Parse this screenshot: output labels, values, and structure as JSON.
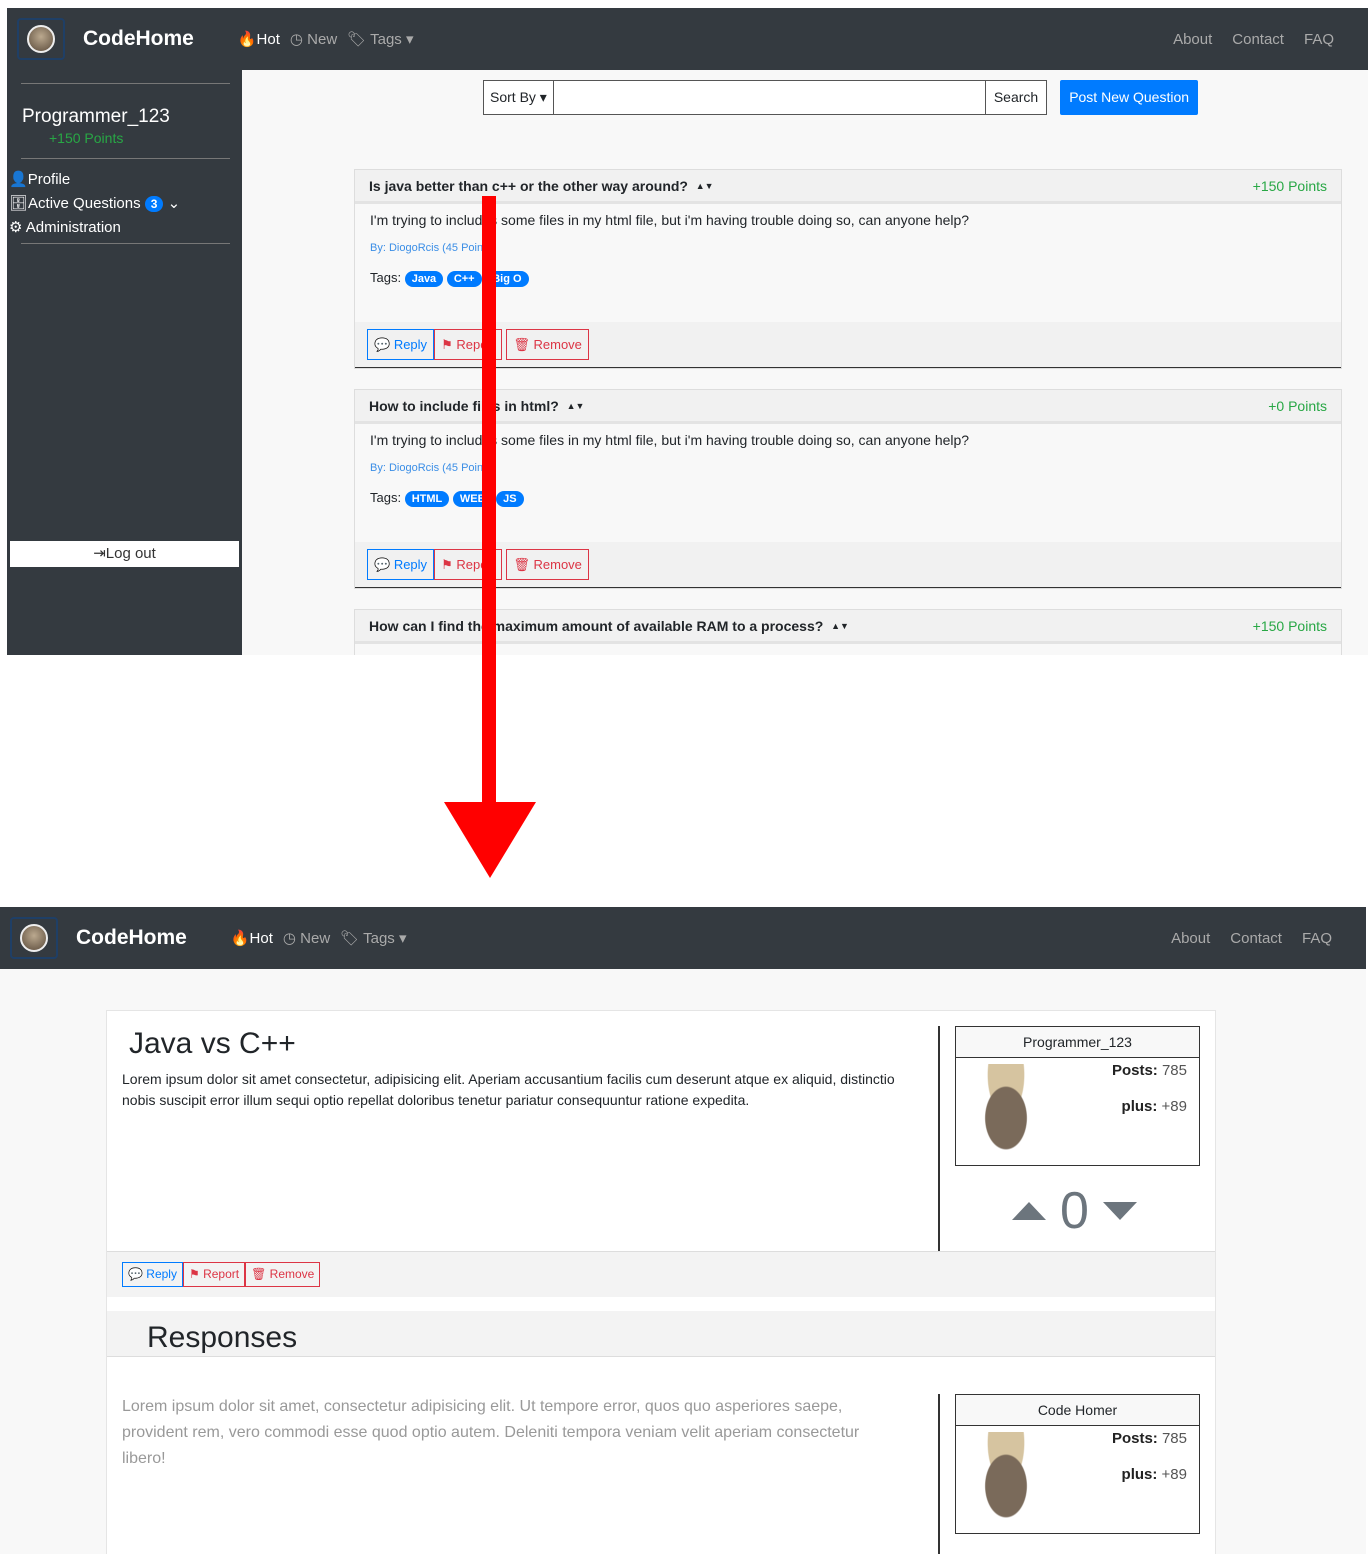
{
  "nav": {
    "brand": "CodeHome",
    "hot": "Hot",
    "new": "New",
    "tags": "Tags",
    "about": "About",
    "contact": "Contact",
    "faq": "FAQ"
  },
  "sidebar": {
    "username": "Programmer_123",
    "points": "+150 Points",
    "profile": "Profile",
    "active_questions": "Active Questions",
    "active_count": "3",
    "administration": "Administration",
    "logout": "Log out"
  },
  "toolbar": {
    "sort": "Sort By",
    "search_value": "",
    "search_button": "Search",
    "post_button": "Post New Question"
  },
  "questions": [
    {
      "title": "Is java better than c++ or the other way around?",
      "points": "+150 Points",
      "body": "I'm trying to includes some files in my html file, but i'm having trouble doing so, can anyone help?",
      "by": "By: DiogoRcis (45 Points)",
      "tags_label": "Tags:",
      "tags": [
        "Java",
        "C++",
        "Big O"
      ]
    },
    {
      "title": "How to include files in html?",
      "points": "+0 Points",
      "body": "I'm trying to includes some files in my html file, but i'm having trouble doing so, can anyone help?",
      "by": "By: DiogoRcis (45 Points)",
      "tags_label": "Tags:",
      "tags": [
        "HTML",
        "WEB",
        "JS"
      ]
    },
    {
      "title": "How can I find the maximum amount of available RAM to a process?",
      "points": "+150 Points"
    }
  ],
  "actions": {
    "reply": "Reply",
    "report": "Report",
    "remove": "Remove"
  },
  "detail": {
    "title": "Java vs C++",
    "body": "Lorem ipsum dolor sit amet consectetur, adipisicing elit. Aperiam accusantium facilis cum deserunt atque ex aliquid, distinctio nobis suscipit error illum sequi optio repellat doloribus tenetur pariatur consequuntur ratione expedita.",
    "author": "Programmer_123",
    "posts_label": "Posts:",
    "posts": "785",
    "plus_label": "plus:",
    "plus": "+89",
    "votes": "0",
    "responses_title": "Responses",
    "response": {
      "body": "Lorem ipsum dolor sit amet, consectetur adipisicing elit. Ut tempore error, quos quo asperiores saepe, provident rem, vero commodi esse quod optio autem. Deleniti tempora veniam velit aperiam consectetur libero!",
      "author": "Code Homer",
      "posts": "785",
      "plus": "+89"
    }
  },
  "colors": {
    "navbar": "#343a40",
    "primary": "#007bff",
    "danger": "#dc3545",
    "success": "#28a745",
    "arrow": "#ff0000"
  }
}
